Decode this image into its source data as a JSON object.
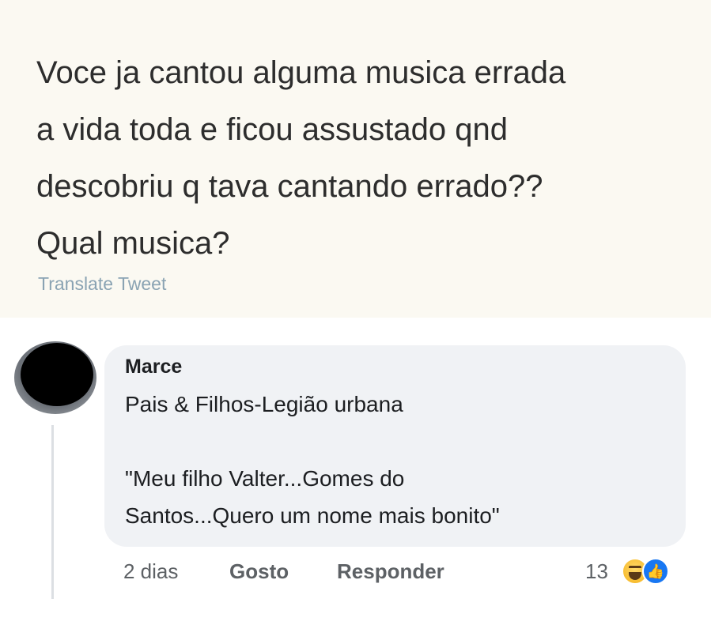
{
  "tweet": {
    "lines": [
      "Voce ja cantou alguma musica errada",
      "a vida toda e ficou assustado qnd",
      "descobriu q tava cantando errado??",
      "Qual musica?"
    ],
    "translate_label": "Translate Tweet"
  },
  "comment": {
    "author": "Marce",
    "lines": [
      "Pais & Filhos-Legião urbana",
      "\"Meu filho Valter...Gomes do",
      "Santos...Quero um nome mais bonito\""
    ],
    "time": "2 dias",
    "like_label": "Gosto",
    "reply_label": "Responder",
    "reaction_count": "13",
    "reaction_icons": [
      "haha-icon",
      "like-icon"
    ]
  },
  "colors": {
    "tweet_background": "#fbf9f2",
    "translate_link": "#8aa3b3",
    "comment_bubble": "#f0f2f5",
    "like_reaction": "#1877f2"
  }
}
